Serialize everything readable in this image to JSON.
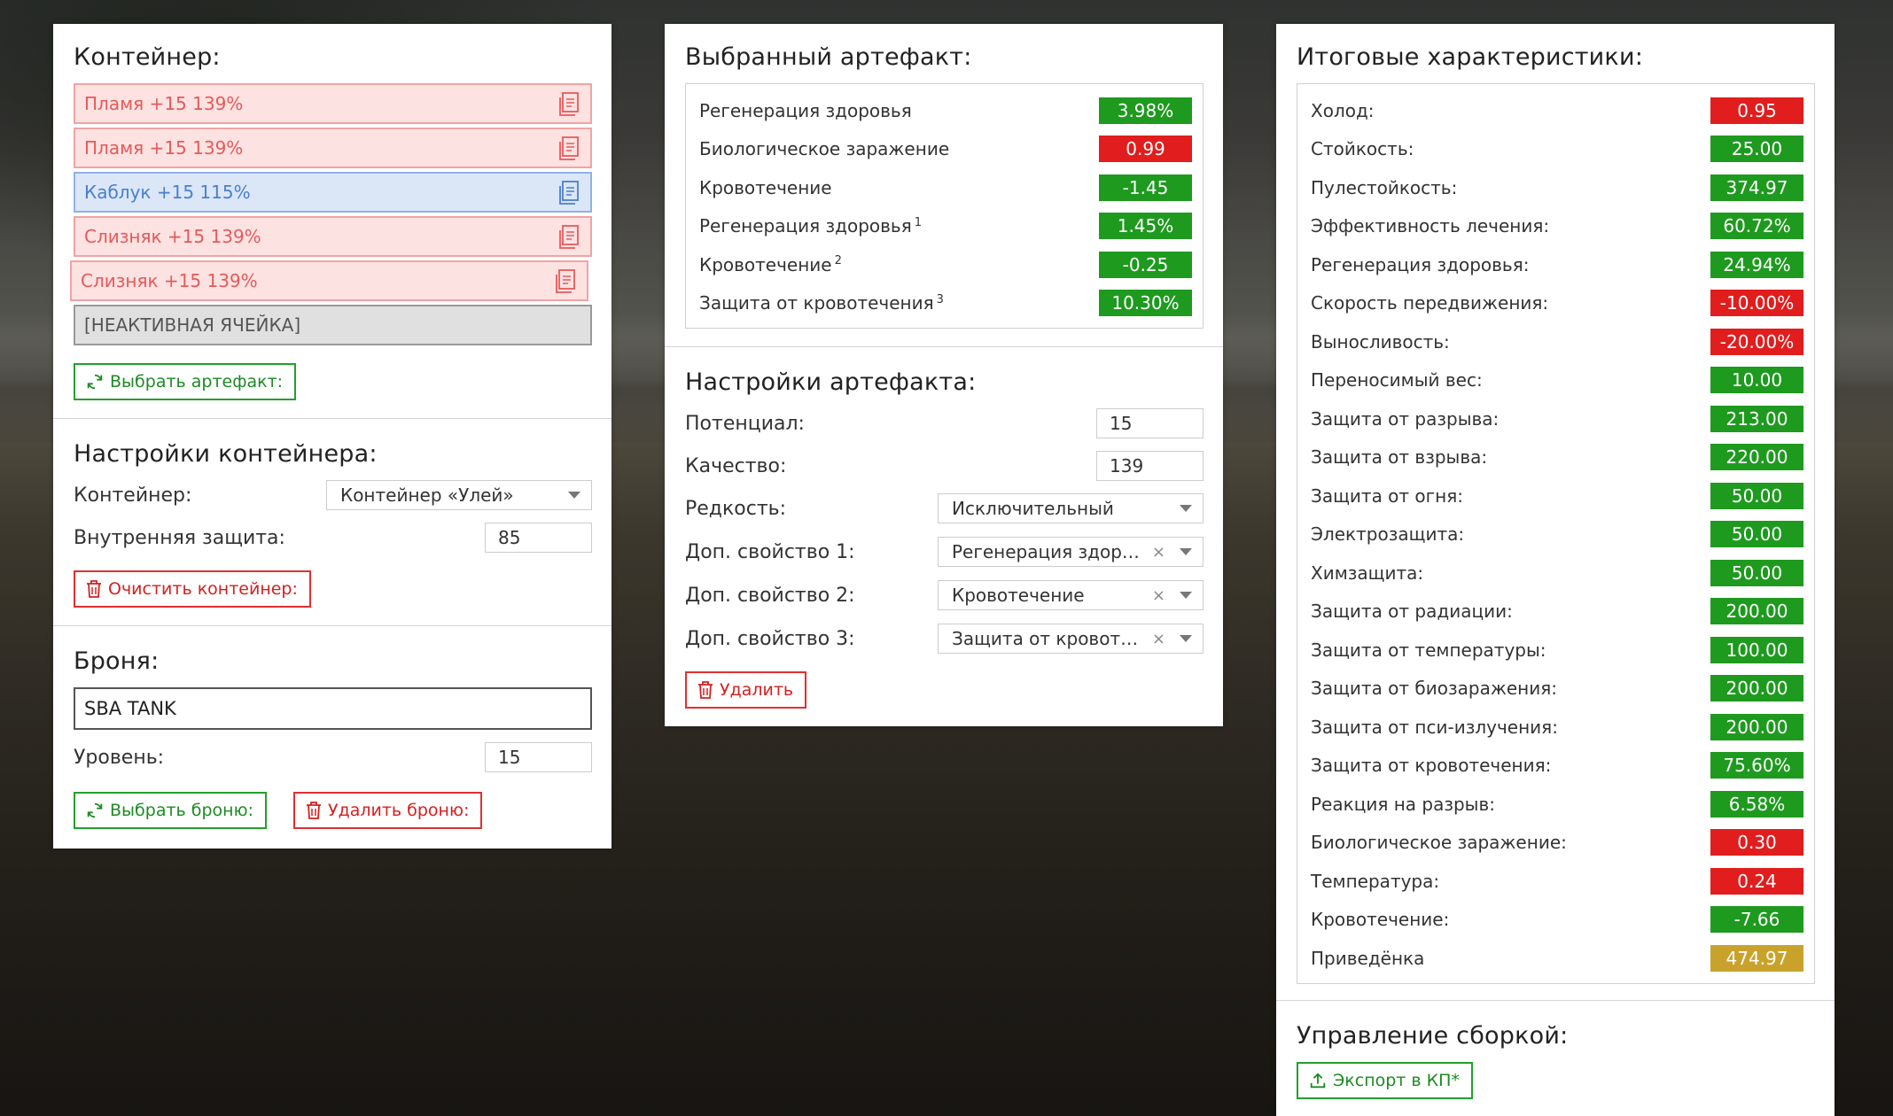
{
  "container_panel": {
    "title": "Контейнер:",
    "slots": [
      {
        "label": "Пламя +15 139%",
        "kind": "red"
      },
      {
        "label": "Пламя +15 139%",
        "kind": "red"
      },
      {
        "label": "Каблук +15 115%",
        "kind": "blue"
      },
      {
        "label": "Слизняк +15 139%",
        "kind": "red"
      },
      {
        "label": "Слизняк +15 139%",
        "kind": "red"
      },
      {
        "label": "[НЕАКТИВНАЯ ЯЧЕЙКА]",
        "kind": "inactive"
      }
    ],
    "select_artifact_button": "Выбрать артефакт:",
    "settings_title": "Настройки контейнера:",
    "container_label": "Контейнер:",
    "container_value": "Контейнер «Улей»",
    "inner_protection_label": "Внутренняя защита:",
    "inner_protection_value": "85",
    "clear_button": "Очистить контейнер:",
    "armor_title": "Броня:",
    "armor_value": "SBA TANK",
    "level_label": "Уровень:",
    "level_value": "15",
    "select_armor_button": "Выбрать броню:",
    "delete_armor_button": "Удалить броню:"
  },
  "artifact_panel": {
    "title": "Выбранный артефакт:",
    "stats": [
      {
        "name": "Регенерация здоровья",
        "sup": "",
        "value": "3.98%",
        "color": "green"
      },
      {
        "name": "Биологическое заражение",
        "sup": "",
        "value": "0.99",
        "color": "red"
      },
      {
        "name": "Кровотечение",
        "sup": "",
        "value": "-1.45",
        "color": "green"
      },
      {
        "name": "Регенерация здоровья",
        "sup": "1",
        "value": "1.45%",
        "color": "green"
      },
      {
        "name": "Кровотечение",
        "sup": "2",
        "value": "-0.25",
        "color": "green"
      },
      {
        "name": "Защита от кровотечения",
        "sup": "3",
        "value": "10.30%",
        "color": "green"
      }
    ],
    "settings_title": "Настройки артефакта:",
    "potential_label": "Потенциал:",
    "potential_value": "15",
    "quality_label": "Качество:",
    "quality_value": "139",
    "rarity_label": "Редкость:",
    "rarity_value": "Исключительный",
    "extra1_label": "Доп. свойство 1:",
    "extra1_value": "Регенерация здоровья",
    "extra2_label": "Доп. свойство 2:",
    "extra2_value": "Кровотечение",
    "extra3_label": "Доп. свойство 3:",
    "extra3_value": "Защита от кровотечения",
    "clear_symbol": "×",
    "delete_button": "Удалить"
  },
  "totals_panel": {
    "title": "Итоговые характеристики:",
    "stats": [
      {
        "name": "Холод:",
        "value": "0.95",
        "color": "red"
      },
      {
        "name": "Стойкость:",
        "value": "25.00",
        "color": "green"
      },
      {
        "name": "Пулестойкость:",
        "value": "374.97",
        "color": "green"
      },
      {
        "name": "Эффективность лечения:",
        "value": "60.72%",
        "color": "green"
      },
      {
        "name": "Регенерация здоровья:",
        "value": "24.94%",
        "color": "green"
      },
      {
        "name": "Скорость передвижения:",
        "value": "-10.00%",
        "color": "red"
      },
      {
        "name": "Выносливость:",
        "value": "-20.00%",
        "color": "red"
      },
      {
        "name": "Переносимый вес:",
        "value": "10.00",
        "color": "green"
      },
      {
        "name": "Защита от разрыва:",
        "value": "213.00",
        "color": "green"
      },
      {
        "name": "Защита от взрыва:",
        "value": "220.00",
        "color": "green"
      },
      {
        "name": "Защита от огня:",
        "value": "50.00",
        "color": "green"
      },
      {
        "name": "Электрозащита:",
        "value": "50.00",
        "color": "green"
      },
      {
        "name": "Химзащита:",
        "value": "50.00",
        "color": "green"
      },
      {
        "name": "Защита от радиации:",
        "value": "200.00",
        "color": "green"
      },
      {
        "name": "Защита от температуры:",
        "value": "100.00",
        "color": "green"
      },
      {
        "name": "Защита от биозаражения:",
        "value": "200.00",
        "color": "green"
      },
      {
        "name": "Защита от пси-излучения:",
        "value": "200.00",
        "color": "green"
      },
      {
        "name": "Защита от кровотечения:",
        "value": "75.60%",
        "color": "green"
      },
      {
        "name": "Реакция на разрыв:",
        "value": "6.58%",
        "color": "green"
      },
      {
        "name": "Биологическое заражение:",
        "value": "0.30",
        "color": "red"
      },
      {
        "name": "Температура:",
        "value": "0.24",
        "color": "red"
      },
      {
        "name": "Кровотечение:",
        "value": "-7.66",
        "color": "green"
      },
      {
        "name": "Приведёнка",
        "value": "474.97",
        "color": "yellow"
      }
    ],
    "build_title": "Управление сборкой:",
    "export_button": "Экспорт в КП*"
  },
  "colors": {
    "green": "#1e9a1f",
    "red": "#e11d1d",
    "yellow": "#c8a22b",
    "button_green": "#22a02b",
    "button_red": "#e03030"
  }
}
